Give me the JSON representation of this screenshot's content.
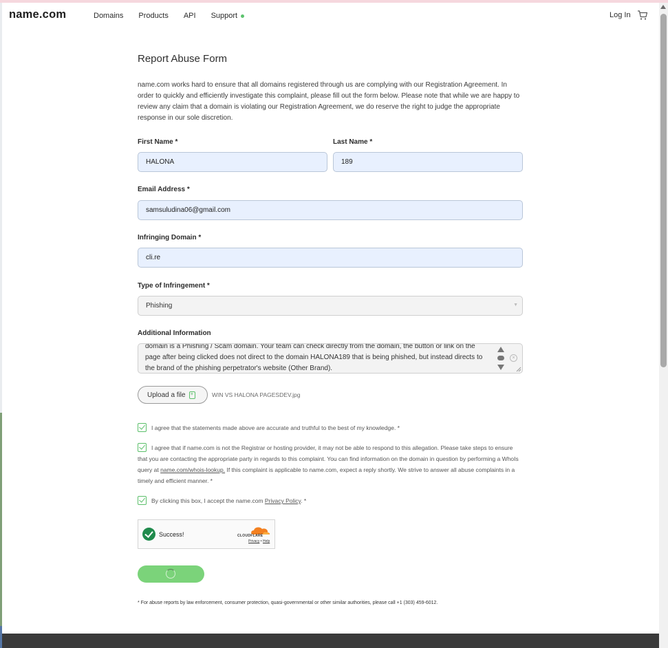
{
  "header": {
    "logo": "name.com",
    "nav": [
      "Domains",
      "Products",
      "API",
      "Support"
    ],
    "login": "Log In"
  },
  "form": {
    "title": "Report Abuse Form",
    "intro": "name.com works hard to ensure that all domains registered through us are complying with our Registration Agreement. In order to quickly and efficiently investigate this complaint, please fill out the form below. Please note that while we are happy to review any claim that a domain is violating our Registration Agreement, we do reserve the right to judge the appropriate response in our sole discretion.",
    "first_name": {
      "label": "First Name *",
      "value": "HALONA"
    },
    "last_name": {
      "label": "Last Name *",
      "value": "189"
    },
    "email": {
      "label": "Email Address *",
      "value": "samsuludina06@gmail.com"
    },
    "domain": {
      "label": "Infringing Domain *",
      "value": "cli.re"
    },
    "infringement_type": {
      "label": "Type of Infringement *",
      "value": "Phishing"
    },
    "additional_info": {
      "label": "Additional Information",
      "value": "domain is a Phishing / Scam domain. Your team can check directly from the domain, the button or link on the page after being clicked does not direct to the domain HALONA189 that is being phished, but instead directs to the brand of the phishing perpetrator's website (Other Brand)."
    },
    "upload": {
      "label": "Upload a file",
      "file_name": "WIN VS HALONA PAGESDEV.jpg"
    },
    "agreements": [
      {
        "text": "I agree that the statements made above are accurate and truthful to the best of my knowledge. *",
        "checked": true
      },
      {
        "text_before": "I agree that if name.com is not the Registrar or hosting provider, it may not be able to respond to this allegation. Please take steps to ensure that you are contacting the appropriate party in regards to this complaint. You can find information on the domain in question by performing a WhoIs query at ",
        "link": "name.com/whois-lookup.",
        "text_after": " If this complaint is applicable to name.com, expect a reply shortly. We strive to answer all abuse complaints in a timely and efficient manner. *",
        "checked": true
      },
      {
        "text_before": "By clicking this box, I accept the name.com ",
        "link": "Privacy Policy",
        "text_after": ". *",
        "checked": true
      }
    ],
    "captcha": {
      "status": "Success!",
      "brand": "CLOUDFLARE",
      "privacy": "Privacy",
      "sep": "•",
      "help": "Help"
    },
    "footnote": "* For abuse reports by law enforcement, consumer protection, quasi-governmental or other similar authorities, please call +1 (303) 459-6012."
  },
  "colors": {
    "accent_green": "#5cc36e",
    "submit_green": "#7bd37a",
    "input_bg": "#e8f0fe"
  }
}
